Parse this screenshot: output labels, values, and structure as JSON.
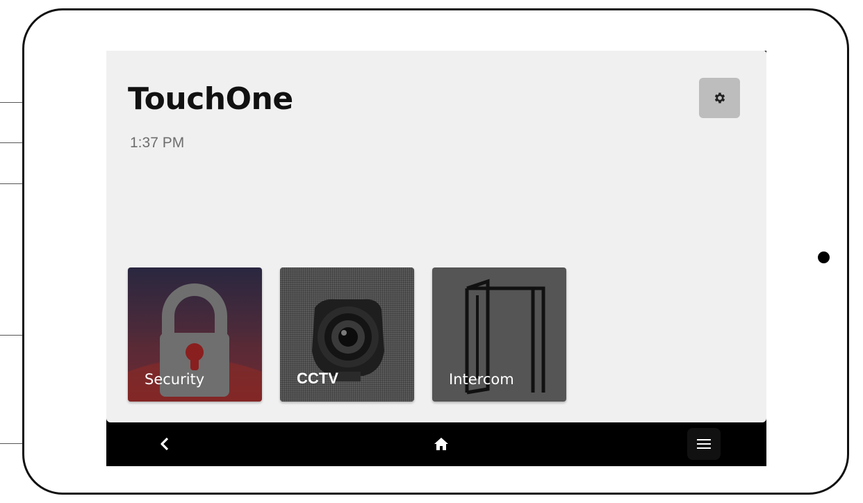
{
  "app": {
    "title": "TouchOne",
    "time": "1:37 PM"
  },
  "header": {
    "settings_icon": "gear-icon"
  },
  "tiles": [
    {
      "label": "Security",
      "icon": "padlock-icon"
    },
    {
      "label": "CCTV",
      "icon": "camera-icon"
    },
    {
      "label": "Intercom",
      "icon": "door-icon"
    }
  ],
  "navbar": {
    "back_icon": "chevron-left-icon",
    "home_icon": "home-icon",
    "menu_icon": "hamburger-menu-icon"
  },
  "colors": {
    "screen_background": "#f0f0f0",
    "navbar_background": "#000000",
    "settings_button": "#bdbdbd",
    "tile_security_top": "#2a2740",
    "tile_security_bottom": "#7a2424",
    "tile_cctv": "#5a5a5a",
    "tile_intercom": "#555555"
  }
}
